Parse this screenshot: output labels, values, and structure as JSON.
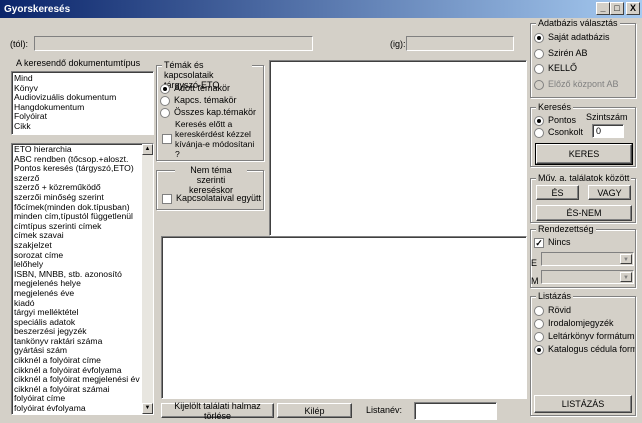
{
  "window": {
    "title": "Gyorskeresés",
    "minimize": "_",
    "maximize": "□",
    "close": "X"
  },
  "range": {
    "from_label": "(tól):",
    "to_label": "(ig):",
    "from_value": "",
    "to_value": ""
  },
  "doctype": {
    "label": "A keresendő dokumentumtípus",
    "items": [
      "Mind",
      "Könyv",
      "Audiovizuális dokumentum",
      "Hangdokumentum",
      "Folyóirat",
      "Cikk"
    ]
  },
  "fields": {
    "items": [
      "ETO hierarchia",
      "ABC rendben (tőcsop.+aloszt.",
      "Pontos keresés (tárgyszó,ETO)",
      "szerző",
      "szerző + közreműködő",
      "szerzői minőség szerint",
      "főcímek(minden dok.típusban)",
      "minden cím,típustól függetlenül",
      "címtípus szerinti címek",
      "címek szavai",
      "szakjelzet",
      "sorozat címe",
      "lelőhely",
      "ISBN, MNBB, stb. azonosító",
      "megjelenés helye",
      "megjelenés éve",
      "kiadó",
      "tárgyi melléktétel",
      "speciális adatok",
      "beszerzési jegyzék",
      "tankönyv raktári száma",
      "gyártási szám",
      "cikknél a folyóirat címe",
      "cikknél a folyóirat évfolyama",
      "cikknél a folyóirat megjelenési év",
      "cikknél a folyóirat számai",
      "folyóirat címe",
      "folyóirat évfolyama"
    ]
  },
  "topics": {
    "legend": "Témák és kapcsolataik tárgyszó-ETO",
    "options": [
      "Adott témakör",
      "Kapcs. témakör",
      "Összes kap.témakör"
    ],
    "selected": 0,
    "confirm_label": "Keresés előtt a kereskérdést kézzel kívánja-e módosítani ?"
  },
  "non_topic": {
    "legend": "Nem téma szerinti kereséskor",
    "check_label": "Kapcsolataival együtt"
  },
  "bottom": {
    "clear_button": "Kijelölt találati halmaz törlése",
    "exit_button": "Kilép",
    "listname_label": "Listanév:",
    "listname_value": ""
  },
  "database": {
    "legend": "Adatbázis választás",
    "options": [
      "Saját adatbázis",
      "Szirén AB",
      "KELLŐ",
      "Előző központ AB"
    ],
    "selected": 0,
    "disabled_index": 3
  },
  "search": {
    "legend": "Keresés",
    "level_label": "Szintszám",
    "options": [
      "Pontos",
      "Csonkolt"
    ],
    "selected": 0,
    "level_value": "0",
    "button": "KERES"
  },
  "ops": {
    "legend": "Műv. a. találatok között",
    "and": "ÉS",
    "or": "VAGY",
    "and_not": "ÉS-NEM"
  },
  "order": {
    "legend": "Rendezettség",
    "none_label": "Nincs",
    "e_label": "E",
    "m_label": "M"
  },
  "listing": {
    "legend": "Listázás",
    "options": [
      "Rövid",
      "Irodalomjegyzék",
      "Leltárkönyv formátum",
      "Katalogus cédula form"
    ],
    "selected": 3,
    "button": "LISTÁZÁS"
  }
}
